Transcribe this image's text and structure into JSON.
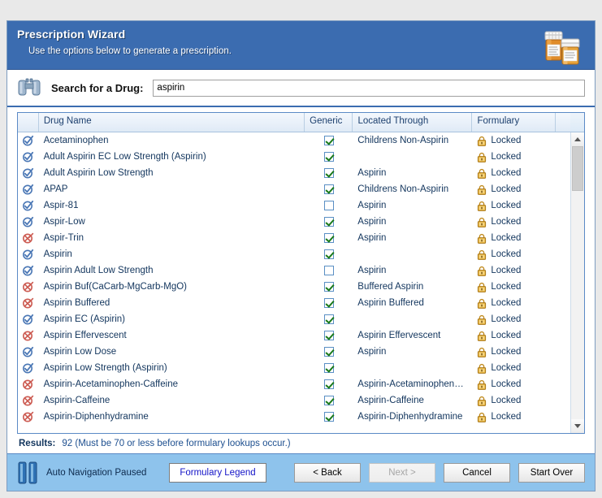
{
  "window": {
    "title": "Prescription Wizard",
    "subtitle": "Use the options below to generate a prescription."
  },
  "search": {
    "label": "Search for a Drug:",
    "value": "aspirin",
    "placeholder": ""
  },
  "grid": {
    "columns": [
      "",
      "Drug Name",
      "Generic",
      "Located Through",
      "Formulary"
    ],
    "rows": [
      {
        "status": "ok",
        "name": "Acetaminophen",
        "generic": true,
        "located": "Childrens Non-Aspirin",
        "formulary": "Locked"
      },
      {
        "status": "ok",
        "name": "Adult Aspirin EC Low Strength (Aspirin)",
        "generic": true,
        "located": "",
        "formulary": "Locked"
      },
      {
        "status": "ok",
        "name": "Adult Aspirin Low Strength",
        "generic": true,
        "located": "Aspirin",
        "formulary": "Locked"
      },
      {
        "status": "ok",
        "name": "APAP",
        "generic": true,
        "located": "Childrens Non-Aspirin",
        "formulary": "Locked"
      },
      {
        "status": "ok",
        "name": "Aspir-81",
        "generic": false,
        "located": "Aspirin",
        "formulary": "Locked"
      },
      {
        "status": "ok",
        "name": "Aspir-Low",
        "generic": true,
        "located": "Aspirin",
        "formulary": "Locked"
      },
      {
        "status": "blocked",
        "name": "Aspir-Trin",
        "generic": true,
        "located": "Aspirin",
        "formulary": "Locked"
      },
      {
        "status": "ok",
        "name": "Aspirin",
        "generic": true,
        "located": "",
        "formulary": "Locked"
      },
      {
        "status": "ok",
        "name": "Aspirin Adult Low Strength",
        "generic": false,
        "located": "Aspirin",
        "formulary": "Locked"
      },
      {
        "status": "blocked",
        "name": "Aspirin Buf(CaCarb-MgCarb-MgO)",
        "generic": true,
        "located": "Buffered Aspirin",
        "formulary": "Locked"
      },
      {
        "status": "blocked",
        "name": "Aspirin Buffered",
        "generic": true,
        "located": "Aspirin Buffered",
        "formulary": "Locked"
      },
      {
        "status": "ok",
        "name": "Aspirin EC (Aspirin)",
        "generic": true,
        "located": "",
        "formulary": "Locked"
      },
      {
        "status": "blocked",
        "name": "Aspirin Effervescent",
        "generic": true,
        "located": "Aspirin Effervescent",
        "formulary": "Locked"
      },
      {
        "status": "ok",
        "name": "Aspirin Low Dose",
        "generic": true,
        "located": "Aspirin",
        "formulary": "Locked"
      },
      {
        "status": "ok",
        "name": "Aspirin Low Strength (Aspirin)",
        "generic": true,
        "located": "",
        "formulary": "Locked"
      },
      {
        "status": "blocked",
        "name": "Aspirin-Acetaminophen-Caffeine",
        "generic": true,
        "located": "Aspirin-Acetaminophen…",
        "formulary": "Locked"
      },
      {
        "status": "blocked",
        "name": "Aspirin-Caffeine",
        "generic": true,
        "located": "Aspirin-Caffeine",
        "formulary": "Locked"
      },
      {
        "status": "blocked",
        "name": "Aspirin-Diphenhydramine",
        "generic": true,
        "located": "Aspirin-Diphenhydramine",
        "formulary": "Locked"
      }
    ]
  },
  "results": {
    "label": "Results:",
    "value": "92 (Must be 70 or less before formulary lookups occur.)"
  },
  "footer": {
    "status": "Auto Navigation Paused",
    "legend_button": "Formulary Legend",
    "back_button": "< Back",
    "next_button": "Next >",
    "cancel_button": "Cancel",
    "startover_button": "Start Over"
  },
  "colors": {
    "header_blue": "#3b6cb0",
    "footer_blue": "#8ec3ec",
    "status_ok": "#4a77b5",
    "status_blocked": "#cc5b52",
    "check_green": "#1a7a1a",
    "lock_gold": "#e8b33c",
    "link_blue": "#1414c8"
  }
}
